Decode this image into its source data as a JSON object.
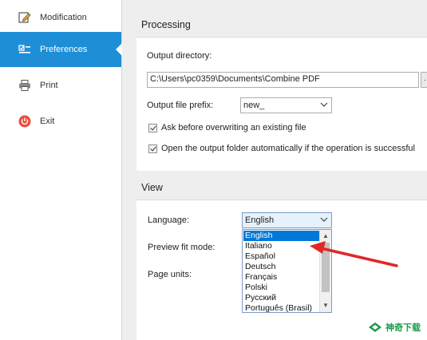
{
  "sidebar": {
    "items": [
      {
        "label": "Modification",
        "icon": "edit-icon",
        "active": false
      },
      {
        "label": "Preferences",
        "icon": "checklist-icon",
        "active": true
      },
      {
        "label": "Print",
        "icon": "printer-icon",
        "active": false
      },
      {
        "label": "Exit",
        "icon": "power-icon",
        "active": false
      }
    ],
    "active_color": "#1e8fd6",
    "exit_icon_color": "#e84c3d"
  },
  "processing": {
    "title": "Processing",
    "output_directory_label": "Output directory:",
    "output_directory_value": "C:\\Users\\pc0359\\Documents\\Combine PDF",
    "output_prefix_label": "Output file prefix:",
    "output_prefix_value": "new_",
    "ask_overwrite_label": "Ask before overwriting an existing file",
    "open_folder_label": "Open the output folder automatically if the operation is successful"
  },
  "view": {
    "title": "View",
    "language_label": "Language:",
    "language_value": "English",
    "preview_fit_label": "Preview fit mode:",
    "page_units_label": "Page units:",
    "language_options": [
      "English",
      "Italiano",
      "Español",
      "Deutsch",
      "Français",
      "Polski",
      "Русский",
      "Português (Brasil)"
    ]
  },
  "watermark": {
    "text": "神奇下载",
    "color": "#1a9a4a"
  }
}
